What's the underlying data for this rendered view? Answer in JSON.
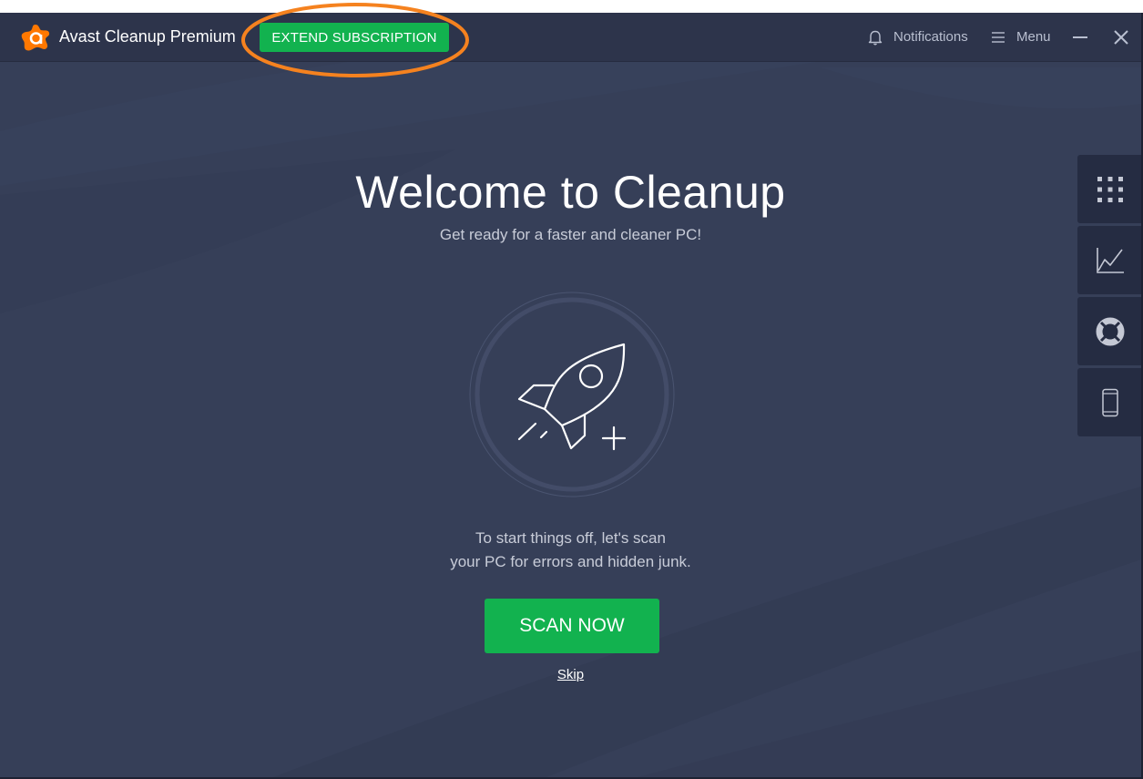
{
  "titlebar": {
    "app_title": "Avast Cleanup Premium",
    "extend_button": "EXTEND SUBSCRIPTION",
    "notifications_label": "Notifications",
    "menu_label": "Menu",
    "icons": {
      "logo": "avast-logo-icon",
      "notifications": "bell-icon",
      "menu": "hamburger-icon",
      "minimize": "minimize-icon",
      "close": "close-icon"
    }
  },
  "side_panel": {
    "items": [
      {
        "name": "apps-grid",
        "icon": "grid-icon"
      },
      {
        "name": "performance",
        "icon": "line-chart-icon"
      },
      {
        "name": "help",
        "icon": "lifebuoy-icon"
      },
      {
        "name": "mobile",
        "icon": "smartphone-icon"
      }
    ]
  },
  "main": {
    "title": "Welcome to Cleanup",
    "subtitle": "Get ready for a faster and cleaner PC!",
    "hero_icon": "rocket-plus-icon",
    "description_line1": "To start things off, let's scan",
    "description_line2": "your PC for errors and hidden junk.",
    "scan_button": "SCAN NOW",
    "skip_link": "Skip"
  },
  "colors": {
    "brand_orange": "#ff7800",
    "accent_green": "#12b24f",
    "background": "#363f58",
    "titlebar": "#2d344b",
    "annotation_orange": "#f5821f"
  }
}
